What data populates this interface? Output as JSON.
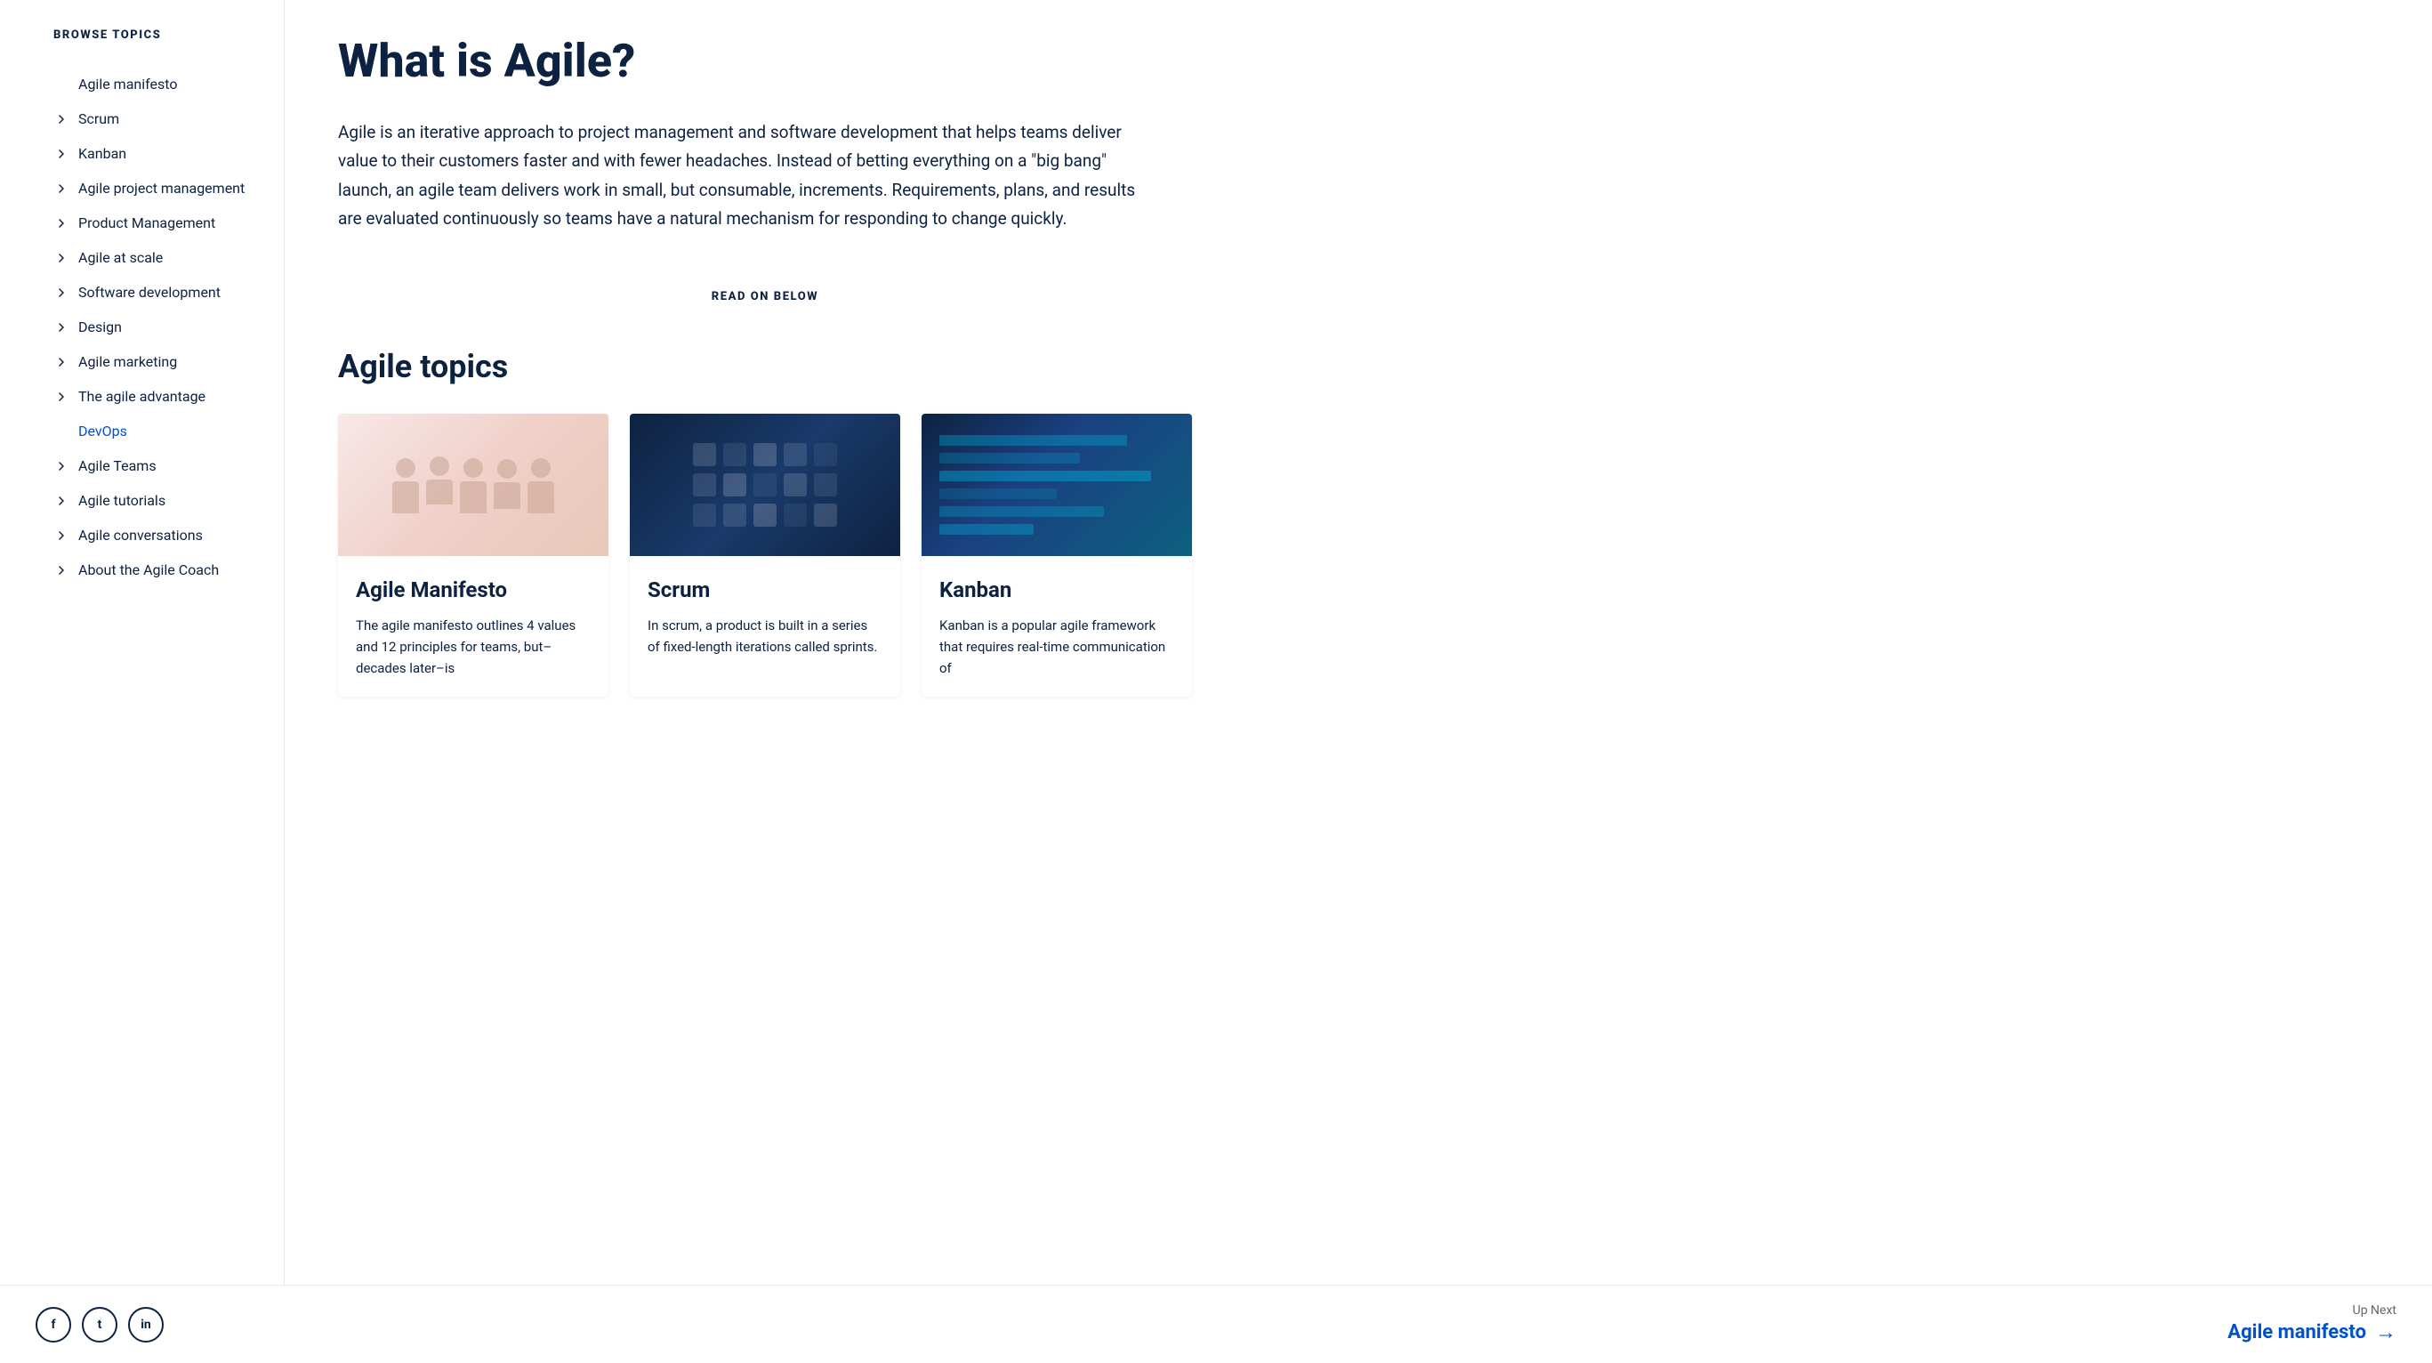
{
  "sidebar": {
    "browse_topics_label": "BROWSE TOPICS",
    "items": [
      {
        "id": "agile-manifesto",
        "label": "Agile manifesto",
        "has_chevron": false,
        "is_plain": true,
        "is_devops": false
      },
      {
        "id": "scrum",
        "label": "Scrum",
        "has_chevron": true,
        "is_plain": false,
        "is_devops": false
      },
      {
        "id": "kanban",
        "label": "Kanban",
        "has_chevron": true,
        "is_plain": false,
        "is_devops": false
      },
      {
        "id": "agile-project-management",
        "label": "Agile project management",
        "has_chevron": true,
        "is_plain": false,
        "is_devops": false
      },
      {
        "id": "product-management",
        "label": "Product Management",
        "has_chevron": true,
        "is_plain": false,
        "is_devops": false
      },
      {
        "id": "agile-at-scale",
        "label": "Agile at scale",
        "has_chevron": true,
        "is_plain": false,
        "is_devops": false
      },
      {
        "id": "software-development",
        "label": "Software development",
        "has_chevron": true,
        "is_plain": false,
        "is_devops": false
      },
      {
        "id": "design",
        "label": "Design",
        "has_chevron": true,
        "is_plain": false,
        "is_devops": false
      },
      {
        "id": "agile-marketing",
        "label": "Agile marketing",
        "has_chevron": true,
        "is_plain": false,
        "is_devops": false
      },
      {
        "id": "agile-advantage",
        "label": "The agile advantage",
        "has_chevron": true,
        "is_plain": false,
        "is_devops": false
      },
      {
        "id": "devops",
        "label": "DevOps",
        "has_chevron": false,
        "is_plain": true,
        "is_devops": true
      },
      {
        "id": "agile-teams",
        "label": "Agile Teams",
        "has_chevron": true,
        "is_plain": false,
        "is_devops": false
      },
      {
        "id": "agile-tutorials",
        "label": "Agile tutorials",
        "has_chevron": true,
        "is_plain": false,
        "is_devops": false
      },
      {
        "id": "agile-conversations",
        "label": "Agile conversations",
        "has_chevron": true,
        "is_plain": false,
        "is_devops": false
      },
      {
        "id": "about-agile-coach",
        "label": "About the Agile Coach",
        "has_chevron": true,
        "is_plain": false,
        "is_devops": false
      }
    ]
  },
  "main": {
    "page_title": "What is Agile?",
    "intro_paragraph": "Agile is an iterative approach to project management and software development that helps teams deliver value to their customers faster and with fewer headaches. Instead of betting everything on a \"big bang\" launch, an agile team delivers work in small, but consumable, increments. Requirements, plans, and results are evaluated continuously so teams have a natural mechanism for responding to change quickly.",
    "read_on_below_label": "READ ON BELOW",
    "section_title": "Agile topics",
    "cards": [
      {
        "id": "agile-manifesto-card",
        "title": "Agile Manifesto",
        "image_type": "manifesto",
        "text": "The agile manifesto outlines 4 values and 12 principles for teams, but–decades later–is"
      },
      {
        "id": "scrum-card",
        "title": "Scrum",
        "image_type": "scrum",
        "text": "In scrum, a product is built in a series of fixed-length iterations called sprints."
      },
      {
        "id": "kanban-card",
        "title": "Kanban",
        "image_type": "kanban",
        "text": "Kanban is a popular agile framework that requires real-time communication of"
      }
    ]
  },
  "footer": {
    "social_icons": [
      {
        "id": "facebook",
        "label": "f",
        "aria": "Facebook"
      },
      {
        "id": "twitter",
        "label": "t",
        "aria": "Twitter"
      },
      {
        "id": "linkedin",
        "label": "in",
        "aria": "LinkedIn"
      }
    ],
    "up_next_label": "Up Next",
    "up_next_link_text": "Agile manifesto"
  }
}
